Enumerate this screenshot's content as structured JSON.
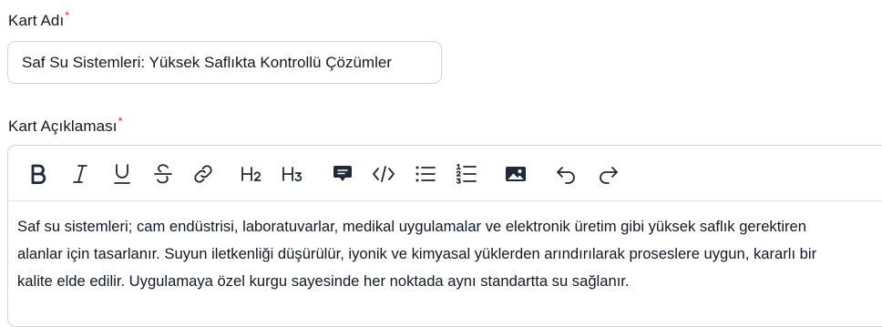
{
  "form": {
    "title_label": "Kart Adı",
    "title_required_mark": "*",
    "title_value": "Saf Su Sistemleri: Yüksek Saflıkta Kontrollü Çözümler",
    "desc_label": "Kart Açıklaması",
    "desc_required_mark": "*"
  },
  "editor": {
    "toolbar": [
      "bold-icon",
      "italic-icon",
      "underline-icon",
      "strikethrough-icon",
      "link-icon",
      "heading-2-icon",
      "heading-3-icon",
      "comment-icon",
      "code-icon",
      "bullet-list-icon",
      "ordered-list-icon",
      "image-icon",
      "undo-icon",
      "redo-icon"
    ],
    "content": "Saf su sistemleri; cam endüstrisi, laboratuvarlar, medikal uygulamalar ve elektronik üretim gibi yüksek saflık gerektiren alanlar için tasarlanır. Suyun iletkenliği düşürülür, iyonik ve kimyasal yüklerden arındırılarak proseslere uygun, kararlı bir kalite elde edilir. Uygulamaya özel kurgu sayesinde her noktada aynı standartta su sağlanır."
  },
  "colors": {
    "required": "#e11d48",
    "border": "#d1d5db",
    "text": "#111827"
  }
}
